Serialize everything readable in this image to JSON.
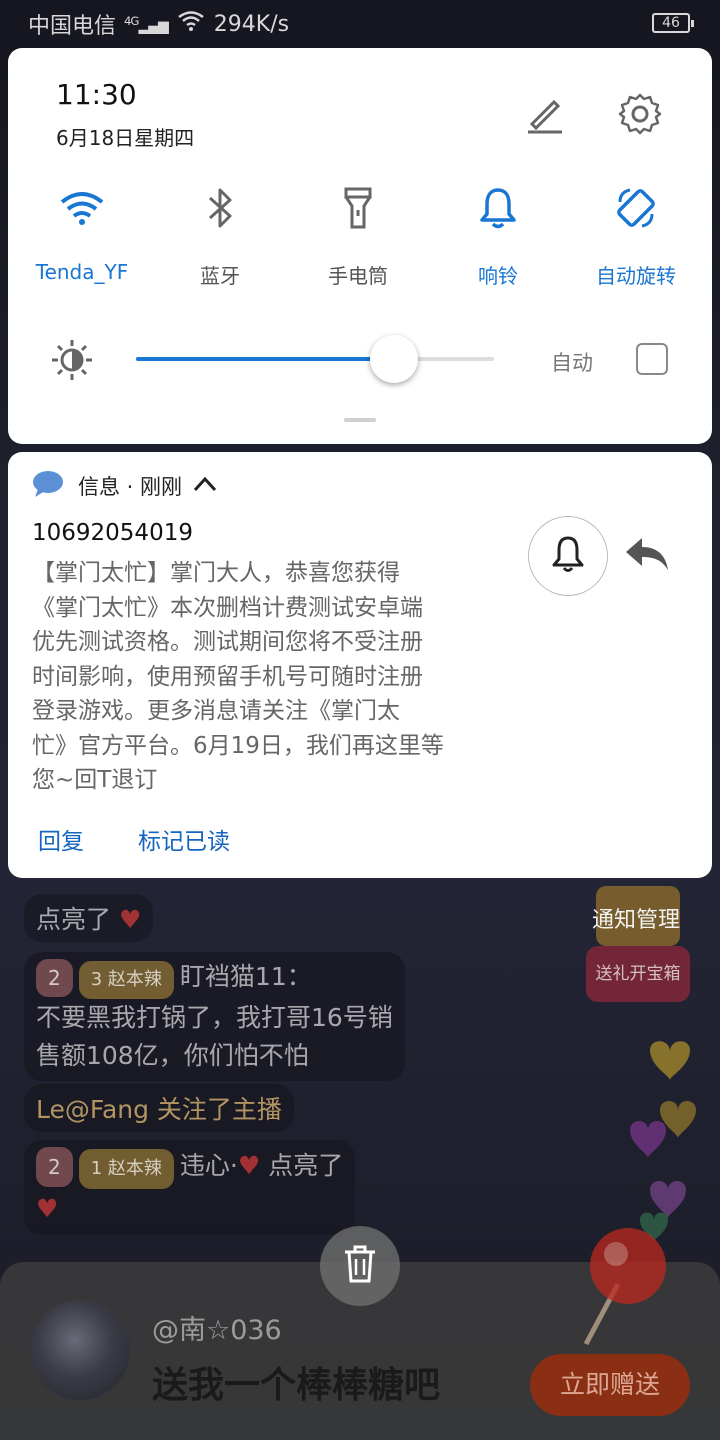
{
  "status_bar": {
    "carrier": "中国电信",
    "network": "4G",
    "speed": "294K/s",
    "battery": "46"
  },
  "quick_settings": {
    "time": "11:30",
    "date": "6月18日星期四",
    "tiles": [
      {
        "label": "Tenda_YF",
        "icon": "wifi-icon",
        "active": true
      },
      {
        "label": "蓝牙",
        "icon": "bluetooth-icon",
        "active": false
      },
      {
        "label": "手电筒",
        "icon": "flashlight-icon",
        "active": false
      },
      {
        "label": "响铃",
        "icon": "bell-icon",
        "active": true
      },
      {
        "label": "自动旋转",
        "icon": "rotate-icon",
        "active": true
      }
    ],
    "brightness_level": 0.72,
    "auto_label": "自动",
    "auto_checked": false,
    "accent_color": "#1976d2"
  },
  "notification": {
    "app_name": "信息 · 刚刚",
    "sender": "10692054019",
    "body_lines": [
      "【掌门太忙】掌门大人，恭喜您获得",
      "《掌门太忙》本次删档计费测试安卓端",
      "优先测试资格。测试期间您将不受注册",
      "时间影响，使用预留手机号可随时注册",
      "登录游戏。更多消息请关注《掌门太",
      "忙》官方平台。6月19日，我们再这里等",
      "您~回T退订"
    ],
    "actions": [
      "回复",
      "标记已读"
    ]
  },
  "background": {
    "notify_mgmt": "通知管理",
    "chat": [
      {
        "text": "点亮了"
      },
      {
        "level": "2",
        "fan_level": "3",
        "fan_name": "赵本辣",
        "user": "盯裆猫11：",
        "msg1": "不要黑我打锅了，我打哥16号销",
        "msg2": "售额108亿，你们怕不怕"
      },
      {
        "text": "Le@Fang 关注了主播"
      },
      {
        "level": "2",
        "fan_level": "1",
        "fan_name": "赵本辣",
        "user": "违心·",
        "msg1": "点亮了"
      }
    ],
    "treasure_label": "送礼开宝箱",
    "gift_user": "@南☆036",
    "gift_message": "送我一个棒棒糖吧",
    "gift_button": "立即赠送"
  }
}
